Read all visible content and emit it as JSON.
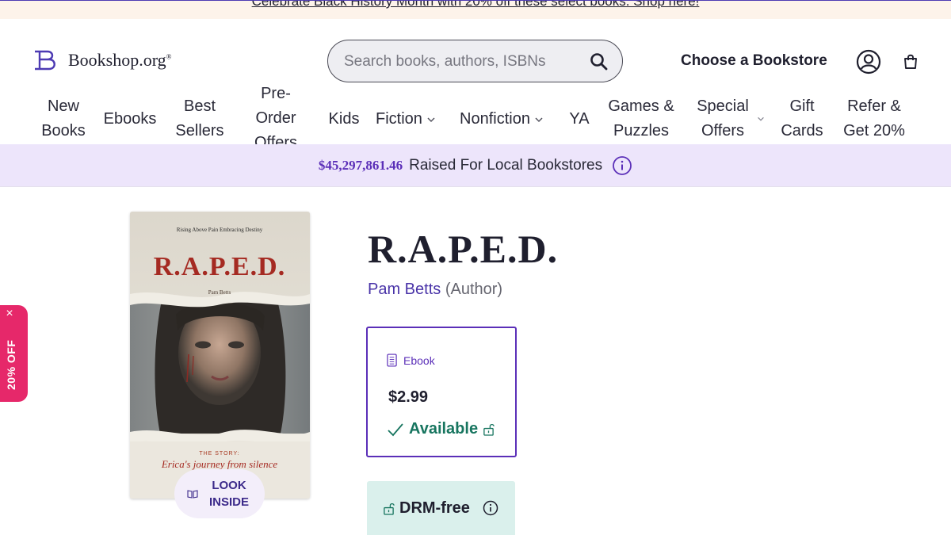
{
  "promo": {
    "text": "Celebrate Black History Month with 20% off these select books. Shop here!"
  },
  "header": {
    "logo_text": "Bookshop.org",
    "logo_mark": "®",
    "search_placeholder": "Search books, authors, ISBNs",
    "choose_store": "Choose a Bookstore",
    "icons": {
      "search": "search-icon",
      "account": "user-circle-icon",
      "cart": "shopping-bag-icon"
    }
  },
  "nav": {
    "items": [
      {
        "label": "New Books",
        "line1": "New",
        "line2": "Books"
      },
      {
        "label": "Ebooks"
      },
      {
        "label": "Best Sellers",
        "line1": "Best",
        "line2": "Sellers"
      },
      {
        "label": "Pre-Order Offers",
        "line1": "Pre-",
        "line2": "Order",
        "line3": "Offers"
      },
      {
        "label": "Kids"
      },
      {
        "label": "Fiction"
      },
      {
        "label": "Nonfiction"
      },
      {
        "label": "YA"
      },
      {
        "label": "Games & Puzzles",
        "line1": "Games &",
        "line2": "Puzzles"
      },
      {
        "label": "Special Offers",
        "line1": "Special",
        "line2": "Offers"
      },
      {
        "label": "Gift Cards",
        "line1": "Gift",
        "line2": "Cards"
      },
      {
        "label": "Refer & Get 20%",
        "line1": "Refer &",
        "line2": "Get 20%"
      }
    ]
  },
  "raised": {
    "amount": "$45,297,861.46",
    "text": "Raised For Local Bookstores"
  },
  "book": {
    "title": "R.A.P.E.D.",
    "author": "Pam Betts",
    "author_role": "(Author)",
    "cover": {
      "tagline": "Rising Above Pain Embracing Destiny",
      "title": "R.A.P.E.D.",
      "author": "Pam Betts",
      "kicker": "THE STORY:",
      "subtitle": "Erica's journey from silence"
    },
    "look_inside": "LOOK INSIDE"
  },
  "format": {
    "type": "Ebook",
    "price": "$2.99",
    "availability": "Available"
  },
  "drm": {
    "label": "DRM-free"
  },
  "discount_tab": {
    "label": "20% OFF",
    "close": "×"
  },
  "colors": {
    "brand_purple": "#5b2fb8",
    "available_green": "#17755f",
    "discount_pink": "#e6286a",
    "raised_bg": "#ede5fb",
    "drm_bg": "#daf0ec"
  }
}
